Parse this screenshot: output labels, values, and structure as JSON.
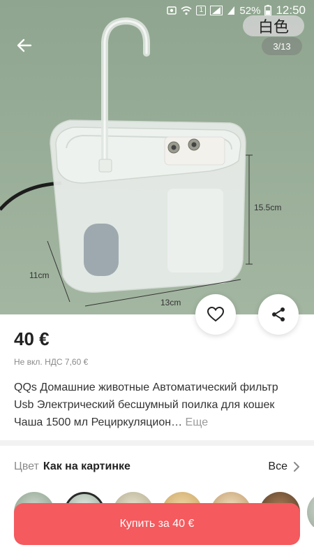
{
  "status_bar": {
    "battery": "52%",
    "time": "12:50",
    "sim_badge": "1"
  },
  "gallery": {
    "color_tag": "白色",
    "counter": "3/13",
    "dimensions": {
      "height": "15.5cm",
      "depth": "11cm",
      "width": "13cm"
    }
  },
  "product": {
    "price": "40 €",
    "vat_note": "Не вкл. НДС 7,60 €",
    "title": "QQs Домашние животные Автоматический фильтр Usb Электрический бесшумный поилка для кошек Чаша 1500 мл Рециркуляцион…",
    "more_label": "Еще"
  },
  "color_selector": {
    "label": "Цвет",
    "value": "Как на картинке",
    "all_label": "Все"
  },
  "buy_button": {
    "label": "Купить за 40 €"
  },
  "colors": {
    "accent": "#f45a5e",
    "background_photo": "#97ac96"
  }
}
